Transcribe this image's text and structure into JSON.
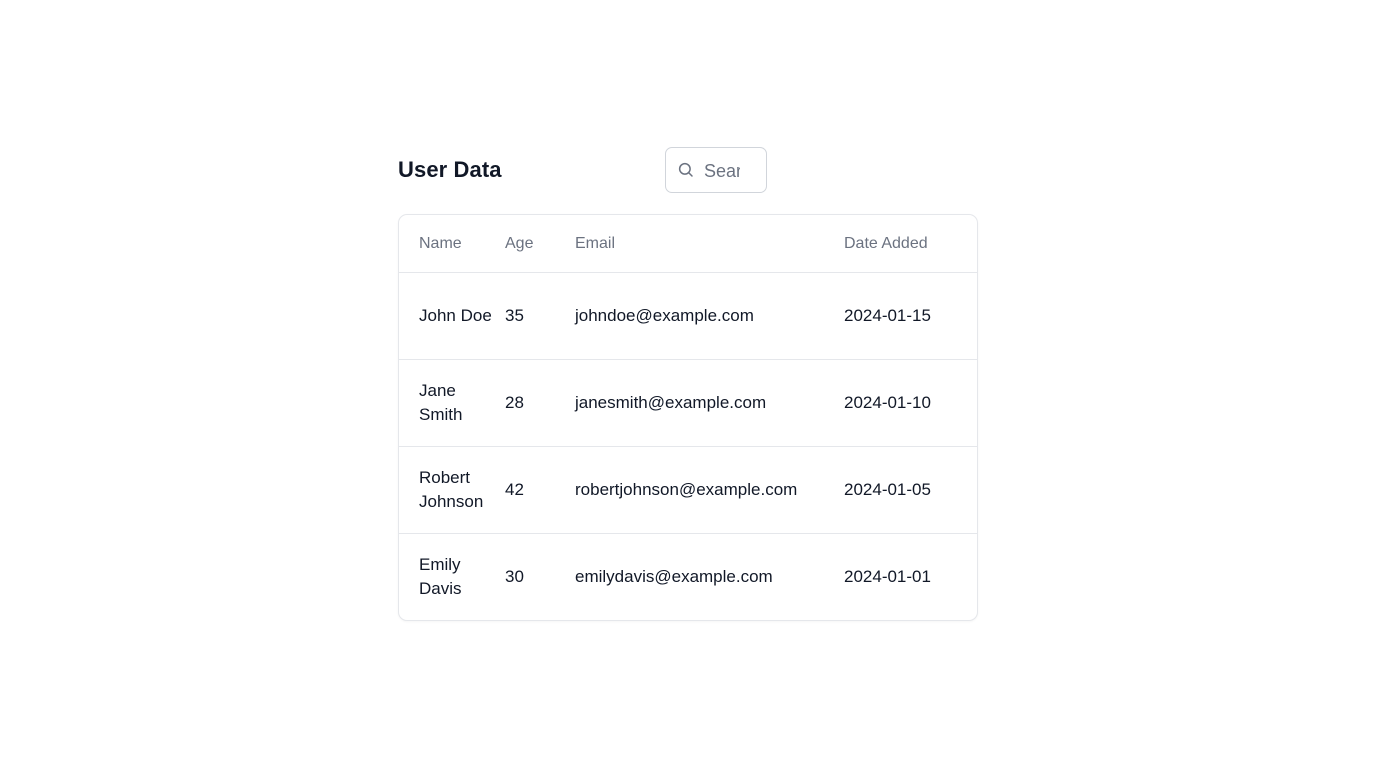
{
  "page": {
    "title": "User Data"
  },
  "search": {
    "placeholder": "Search...",
    "value": ""
  },
  "table": {
    "headers": {
      "name": "Name",
      "age": "Age",
      "email": "Email",
      "date_added": "Date Added"
    },
    "rows": [
      {
        "name": "John Doe",
        "age": "35",
        "email": "johndoe@example.com",
        "date_added": "2024-01-15"
      },
      {
        "name": "Jane Smith",
        "age": "28",
        "email": "janesmith@example.com",
        "date_added": "2024-01-10"
      },
      {
        "name": "Robert Johnson",
        "age": "42",
        "email": "robertjohnson@example.com",
        "date_added": "2024-01-05"
      },
      {
        "name": "Emily Davis",
        "age": "30",
        "email": "emilydavis@example.com",
        "date_added": "2024-01-01"
      }
    ]
  },
  "icons": {
    "search": "search-icon"
  },
  "colors": {
    "text_primary": "#111827",
    "text_muted": "#6b7280",
    "border": "#e5e7eb"
  }
}
